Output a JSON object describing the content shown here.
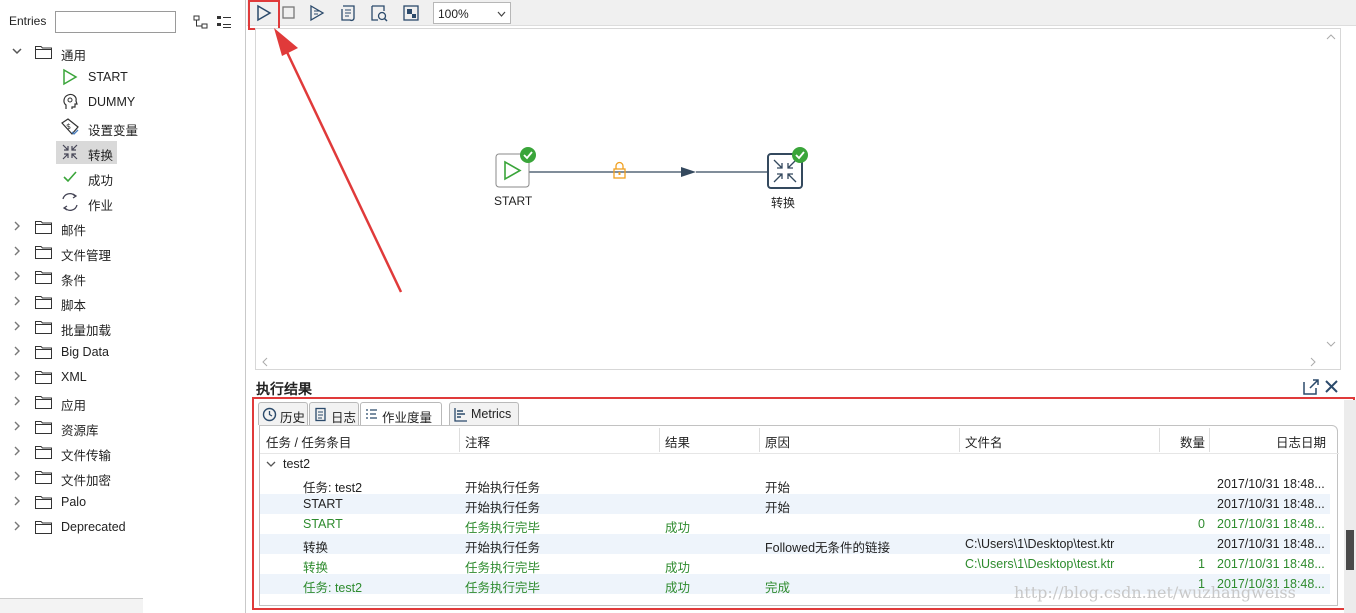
{
  "left_panel": {
    "entries_label": "Entries",
    "entries_value": "",
    "general_folder": "通用",
    "children": [
      "START",
      "DUMMY",
      "设置变量",
      "转换",
      "成功",
      "作业"
    ],
    "folders": [
      "邮件",
      "文件管理",
      "条件",
      "脚本",
      "批量加载",
      "Big Data",
      "XML",
      "应用",
      "资源库",
      "文件传输",
      "文件加密",
      "Palo",
      "Deprecated"
    ]
  },
  "toolbar": {
    "zoom": "100%",
    "icons": [
      "run-icon",
      "stop-icon",
      "replay-icon",
      "check-icon",
      "preview-icon",
      "impact-icon"
    ]
  },
  "canvas": {
    "nodes": [
      {
        "label": "START",
        "status": "success"
      },
      {
        "label": "转换",
        "status": "success"
      }
    ],
    "hop_icon": "lock-icon"
  },
  "results": {
    "title": "执行结果",
    "tabs": [
      "历史",
      "日志",
      "作业度量",
      "Metrics"
    ],
    "active_tab": "作业度量",
    "columns": [
      "任务 / 任务条目",
      "注释",
      "结果",
      "原因",
      "文件名",
      "数量",
      "日志日期"
    ],
    "group": "test2",
    "rows": [
      {
        "entry": "任务: test2",
        "comment": "开始执行任务",
        "result": "",
        "reason": "开始",
        "file": "",
        "count": "",
        "date": "2017/10/31 18:48...",
        "success": false
      },
      {
        "entry": "START",
        "comment": "开始执行任务",
        "result": "",
        "reason": "开始",
        "file": "",
        "count": "",
        "date": "2017/10/31 18:48...",
        "success": false
      },
      {
        "entry": "START",
        "comment": "任务执行完毕",
        "result": "成功",
        "reason": "",
        "file": "",
        "count": "0",
        "date": "2017/10/31 18:48...",
        "success": true
      },
      {
        "entry": "转换",
        "comment": "开始执行任务",
        "result": "",
        "reason": "Followed无条件的链接",
        "file": "C:\\Users\\1\\Desktop\\test.ktr",
        "count": "",
        "date": "2017/10/31 18:48...",
        "success": false
      },
      {
        "entry": "转换",
        "comment": "任务执行完毕",
        "result": "成功",
        "reason": "",
        "file": "C:\\Users\\1\\Desktop\\test.ktr",
        "count": "1",
        "date": "2017/10/31 18:48...",
        "success": true
      },
      {
        "entry": "任务: test2",
        "comment": "任务执行完毕",
        "result": "成功",
        "reason": "完成",
        "file": "",
        "count": "1",
        "date": "2017/10/31 18:48...",
        "success": true
      }
    ]
  },
  "watermark": "http://blog.csdn.net/wuzhangweiss",
  "colors": {
    "accent_red": "#e03a3a",
    "success_green": "#2e8b2e",
    "start_green": "#3aa53a",
    "hop_blue": "#34495e",
    "lock_orange": "#f0a020"
  }
}
